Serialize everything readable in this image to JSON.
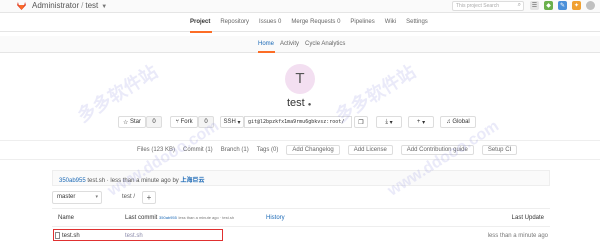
{
  "topbar": {
    "path_owner": "Administrator",
    "path_separator": "/",
    "path_project": "test",
    "search_placeholder": "This project  Search"
  },
  "nav": {
    "items": [
      "Project",
      "Repository",
      "Issues 0",
      "Merge Requests 0",
      "Pipelines",
      "Wiki",
      "Settings"
    ],
    "active": "Project"
  },
  "subnav": {
    "items": [
      "Home",
      "Activity",
      "Cycle Analytics"
    ],
    "active": "Home"
  },
  "project": {
    "avatar_letter": "T",
    "name": "test"
  },
  "actions": {
    "star_label": "Star",
    "star_count": "0",
    "fork_label": "Fork",
    "fork_count": "0",
    "protocol": "SSH",
    "ssh_url": "git@l2bpzkfx1ma9rmu6gbkvsz:root/",
    "notification": "Global"
  },
  "repo_links": {
    "files": "Files (123 KB)",
    "commits": "Commit (1)",
    "branches": "Branch (1)",
    "tags": "Tags (0)",
    "add_changelog": "Add Changelog",
    "add_license": "Add License",
    "add_contrib": "Add Contribution guide",
    "setup_ci": "Setup CI"
  },
  "last_commit": {
    "sha": "350ab955",
    "message": "test.sh",
    "time": "· less than a minute ago by",
    "author": "上海巨云"
  },
  "branch": {
    "name": "master",
    "path": "test",
    "plus": "+"
  },
  "table": {
    "col_name": "Name",
    "col_last_commit": "Last commit",
    "commit_sha": "350ab955",
    "commit_msg": "less than a minute ago · test.sh",
    "history": "History",
    "col_last_update": "Last Update",
    "rows": [
      {
        "name": "test.sh",
        "message": "test.sh",
        "updated": "less than a minute ago"
      }
    ]
  },
  "watermarks": [
    "多多软件站",
    "www.ddooo.com"
  ]
}
